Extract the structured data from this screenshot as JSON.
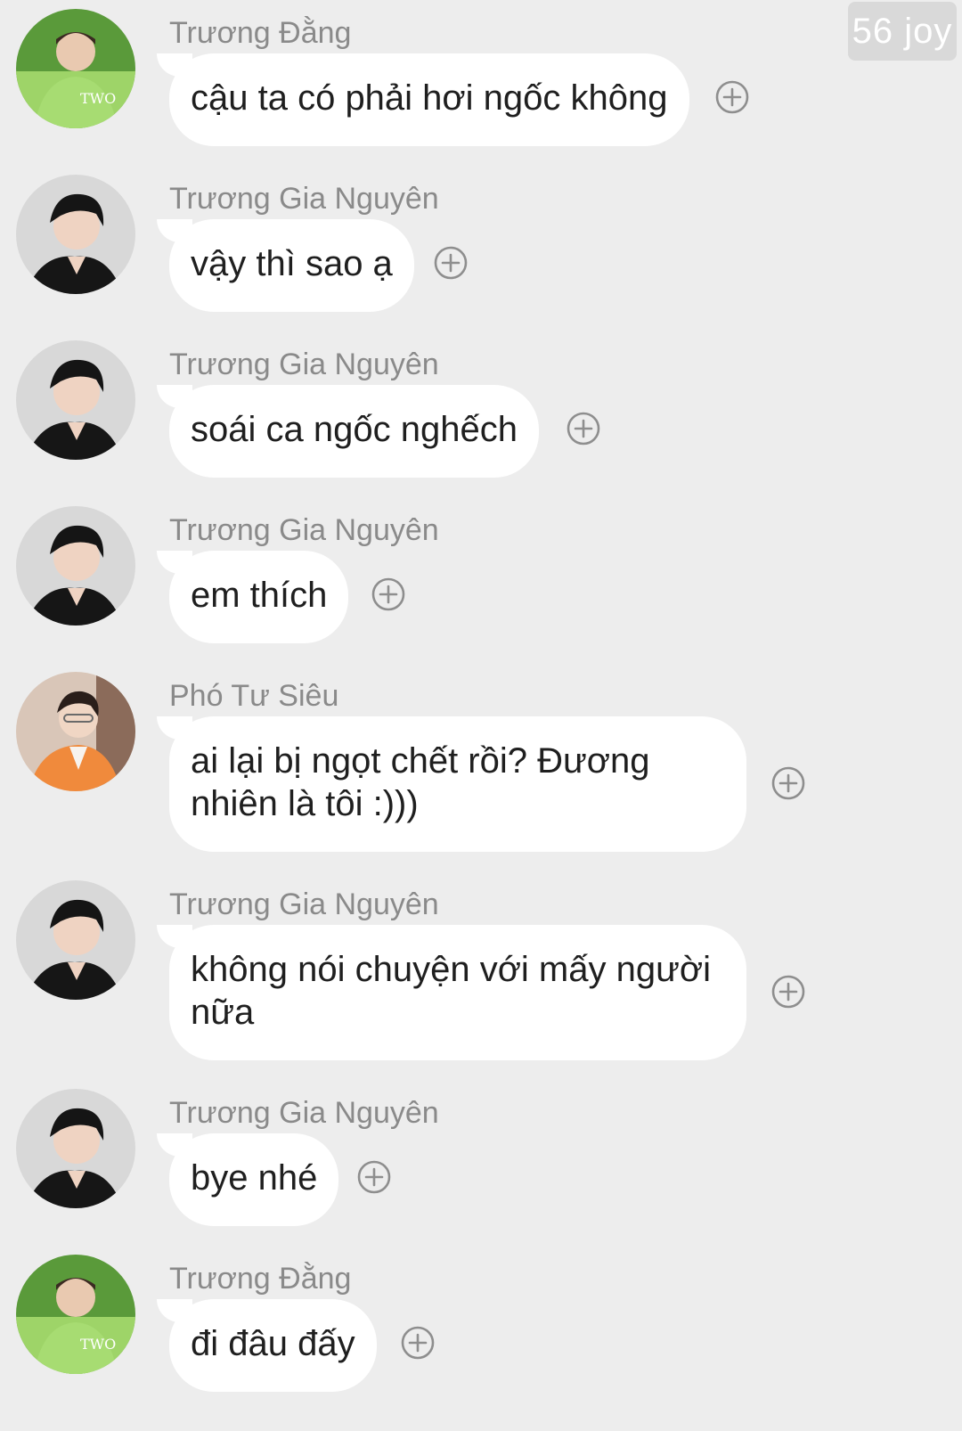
{
  "watermark": "56 joy",
  "icons": {
    "add": "plus-circle-icon"
  },
  "colors": {
    "background": "#ededed",
    "bubble": "#ffffff",
    "sender_name": "#8a8a8a",
    "message_text": "#1f1f1f",
    "add_icon": "#8e8e8e"
  },
  "messages": [
    {
      "sender": "Trương Đằng",
      "text": "cậu ta có phải hơi ngốc không"
    },
    {
      "sender": "Trương Gia Nguyên",
      "text": "vậy thì sao ạ"
    },
    {
      "sender": "Trương Gia Nguyên",
      "text": "soái ca ngốc nghếch"
    },
    {
      "sender": "Trương Gia Nguyên",
      "text": "em thích"
    },
    {
      "sender": "Phó Tư Siêu",
      "text": "ai lại bị ngọt chết rồi? Đương nhiên là tôi :)))"
    },
    {
      "sender": "Trương Gia Nguyên",
      "text": "không nói chuyện với mấy người nữa"
    },
    {
      "sender": "Trương Gia Nguyên",
      "text": "bye nhé"
    },
    {
      "sender": "Trương Đằng",
      "text": "đi đâu đấy"
    }
  ]
}
